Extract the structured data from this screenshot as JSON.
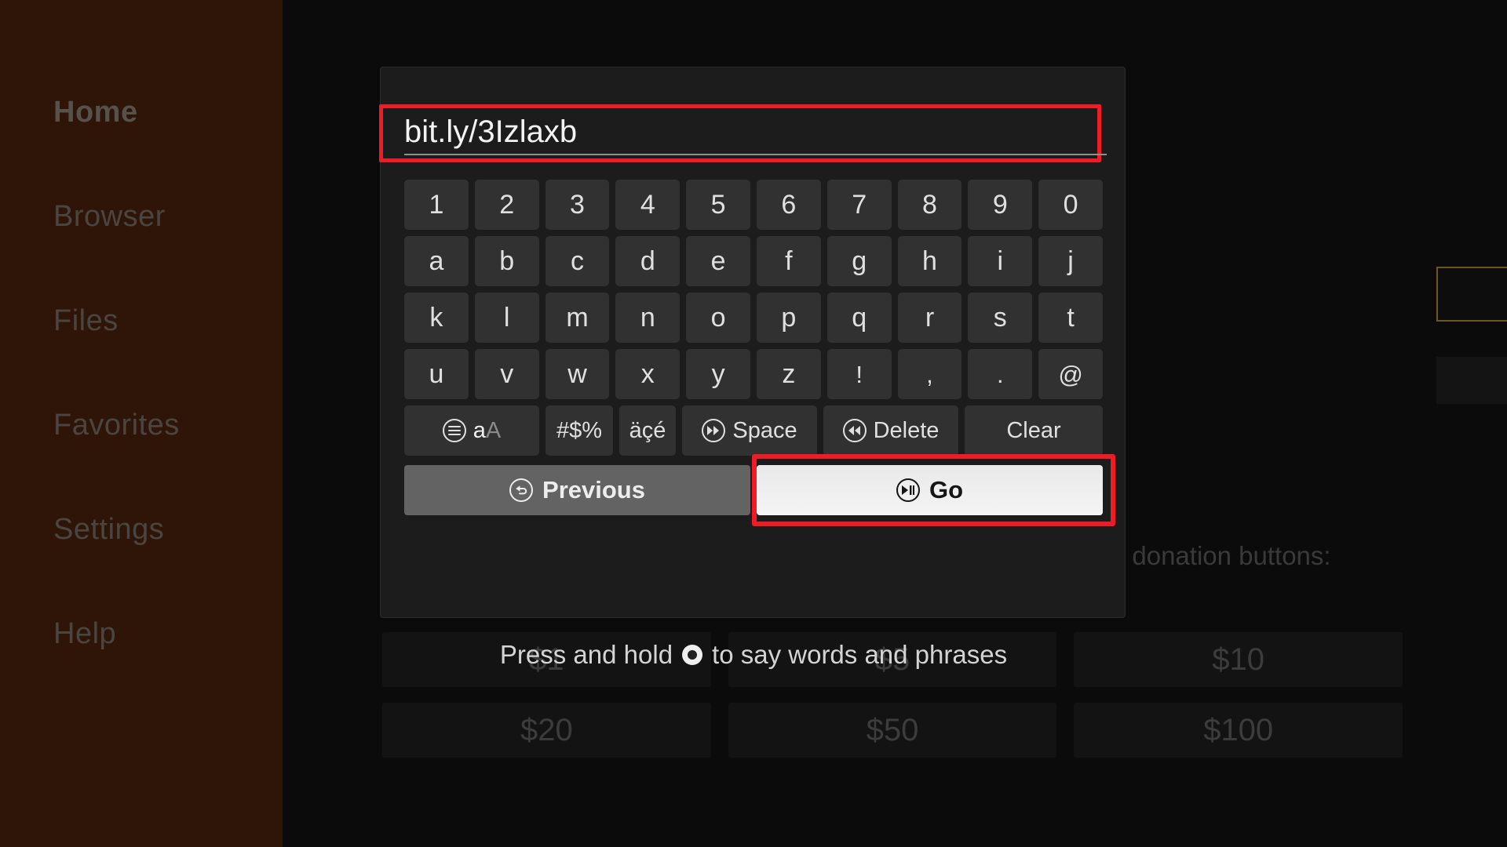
{
  "sidebar": {
    "items": [
      {
        "label": "Home",
        "active": true
      },
      {
        "label": "Browser",
        "active": false
      },
      {
        "label": "Files",
        "active": false
      },
      {
        "label": "Favorites",
        "active": false
      },
      {
        "label": "Settings",
        "active": false
      },
      {
        "label": "Help",
        "active": false
      }
    ]
  },
  "background": {
    "caption_line1": "ase donation buttons:",
    "caption_line2": "$)",
    "donation_rows": [
      [
        "$1",
        "$5",
        "$10"
      ],
      [
        "$20",
        "$50",
        "$100"
      ]
    ]
  },
  "speech_hint": {
    "prefix": "Press and hold",
    "icon": "record-dot-icon",
    "suffix": "to say words and phrases"
  },
  "dialog": {
    "text_field": {
      "value": "bit.ly/3Izlaxb",
      "placeholder": "",
      "highlighted": true
    },
    "keyboard": {
      "rows": [
        [
          "1",
          "2",
          "3",
          "4",
          "5",
          "6",
          "7",
          "8",
          "9",
          "0"
        ],
        [
          "a",
          "b",
          "c",
          "d",
          "e",
          "f",
          "g",
          "h",
          "i",
          "j"
        ],
        [
          "k",
          "l",
          "m",
          "n",
          "o",
          "p",
          "q",
          "r",
          "s",
          "t"
        ],
        [
          "u",
          "v",
          "w",
          "x",
          "y",
          "z",
          "!",
          ",",
          ".",
          "@"
        ]
      ],
      "function_keys": [
        {
          "id": "case",
          "label_a": "a",
          "label_A": "A",
          "icon": "hamburger-circle-icon"
        },
        {
          "id": "symbols",
          "label": "#$%",
          "icon": ""
        },
        {
          "id": "accents",
          "label": "äçé",
          "icon": ""
        },
        {
          "id": "space",
          "label": "Space",
          "icon": "fast-forward-circle-icon"
        },
        {
          "id": "delete",
          "label": "Delete",
          "icon": "rewind-circle-icon"
        },
        {
          "id": "clear",
          "label": "Clear",
          "icon": ""
        }
      ]
    },
    "actions": {
      "previous": {
        "label": "Previous",
        "icon": "back-arrow-circle-icon",
        "highlighted": false
      },
      "go": {
        "label": "Go",
        "icon": "play-pause-circle-icon",
        "highlighted": true
      }
    }
  },
  "colors": {
    "sidebar_bg": "#2e1508",
    "app_bg": "#0a0a0a",
    "dialog_bg": "#1c1c1c",
    "key_bg": "#313131",
    "highlight_red": "#f01b24",
    "go_button_bg": "#efefef",
    "previous_button_bg": "#636363",
    "focus_outline_amber": "#6b5624"
  }
}
